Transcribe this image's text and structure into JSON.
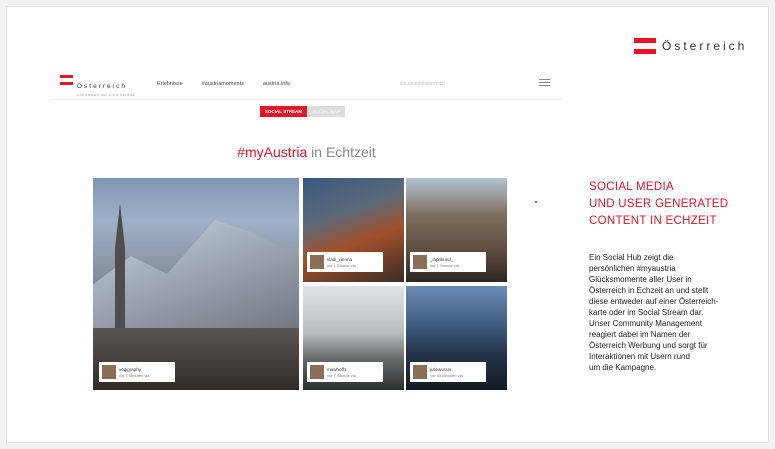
{
  "brand": {
    "name": "Österreich"
  },
  "site": {
    "logo_name": "Österreich",
    "logo_sub": "ANKOMMEN BEI SICH SELBST",
    "nav_links": [
      "Erlebnisse",
      "#austriamoments",
      "austria.info"
    ],
    "hashtag_hint": "ich.urlaubtosterreich",
    "tabs": {
      "active": "SOCIAL STREAM",
      "inactive": "SOCIAL MAP"
    },
    "headline_tag": "#myAustria",
    "headline_rest": " in Echtzeit"
  },
  "posts": [
    {
      "user": "vogigraphy",
      "time": "vor 7 Minuten via"
    },
    {
      "user": "vladi_vienna",
      "time": "vor 1 Stunde via"
    },
    {
      "user": "_laprikund_",
      "time": "vor 1 Stunde via"
    },
    {
      "user": "mawhoff1",
      "time": "vor 7 Stunde via"
    },
    {
      "user": "juliewurzer",
      "time": "vor 43 Minuten via"
    }
  ],
  "side": {
    "title_lines": [
      "SOCIAL MEDIA",
      "UND USER GENERATED",
      "CONTENT IN ECHZEIT"
    ],
    "body_lines": [
      "Ein Social Hub zeigt die",
      "persönlichen #myaustria",
      "Glücksmomente aller User in",
      "Österreich in Echzeit an und stellt",
      "diese entweder auf einer Österreich-",
      "karte oder im Social Stream dar.",
      "Unser Community Management",
      "reagiert dabei im Namen der",
      "Österreich Werbung und sorgt für",
      "Interaktionen mit Usern rund",
      "um die Kampagne."
    ]
  },
  "colors": {
    "accent": "#e3152b"
  }
}
